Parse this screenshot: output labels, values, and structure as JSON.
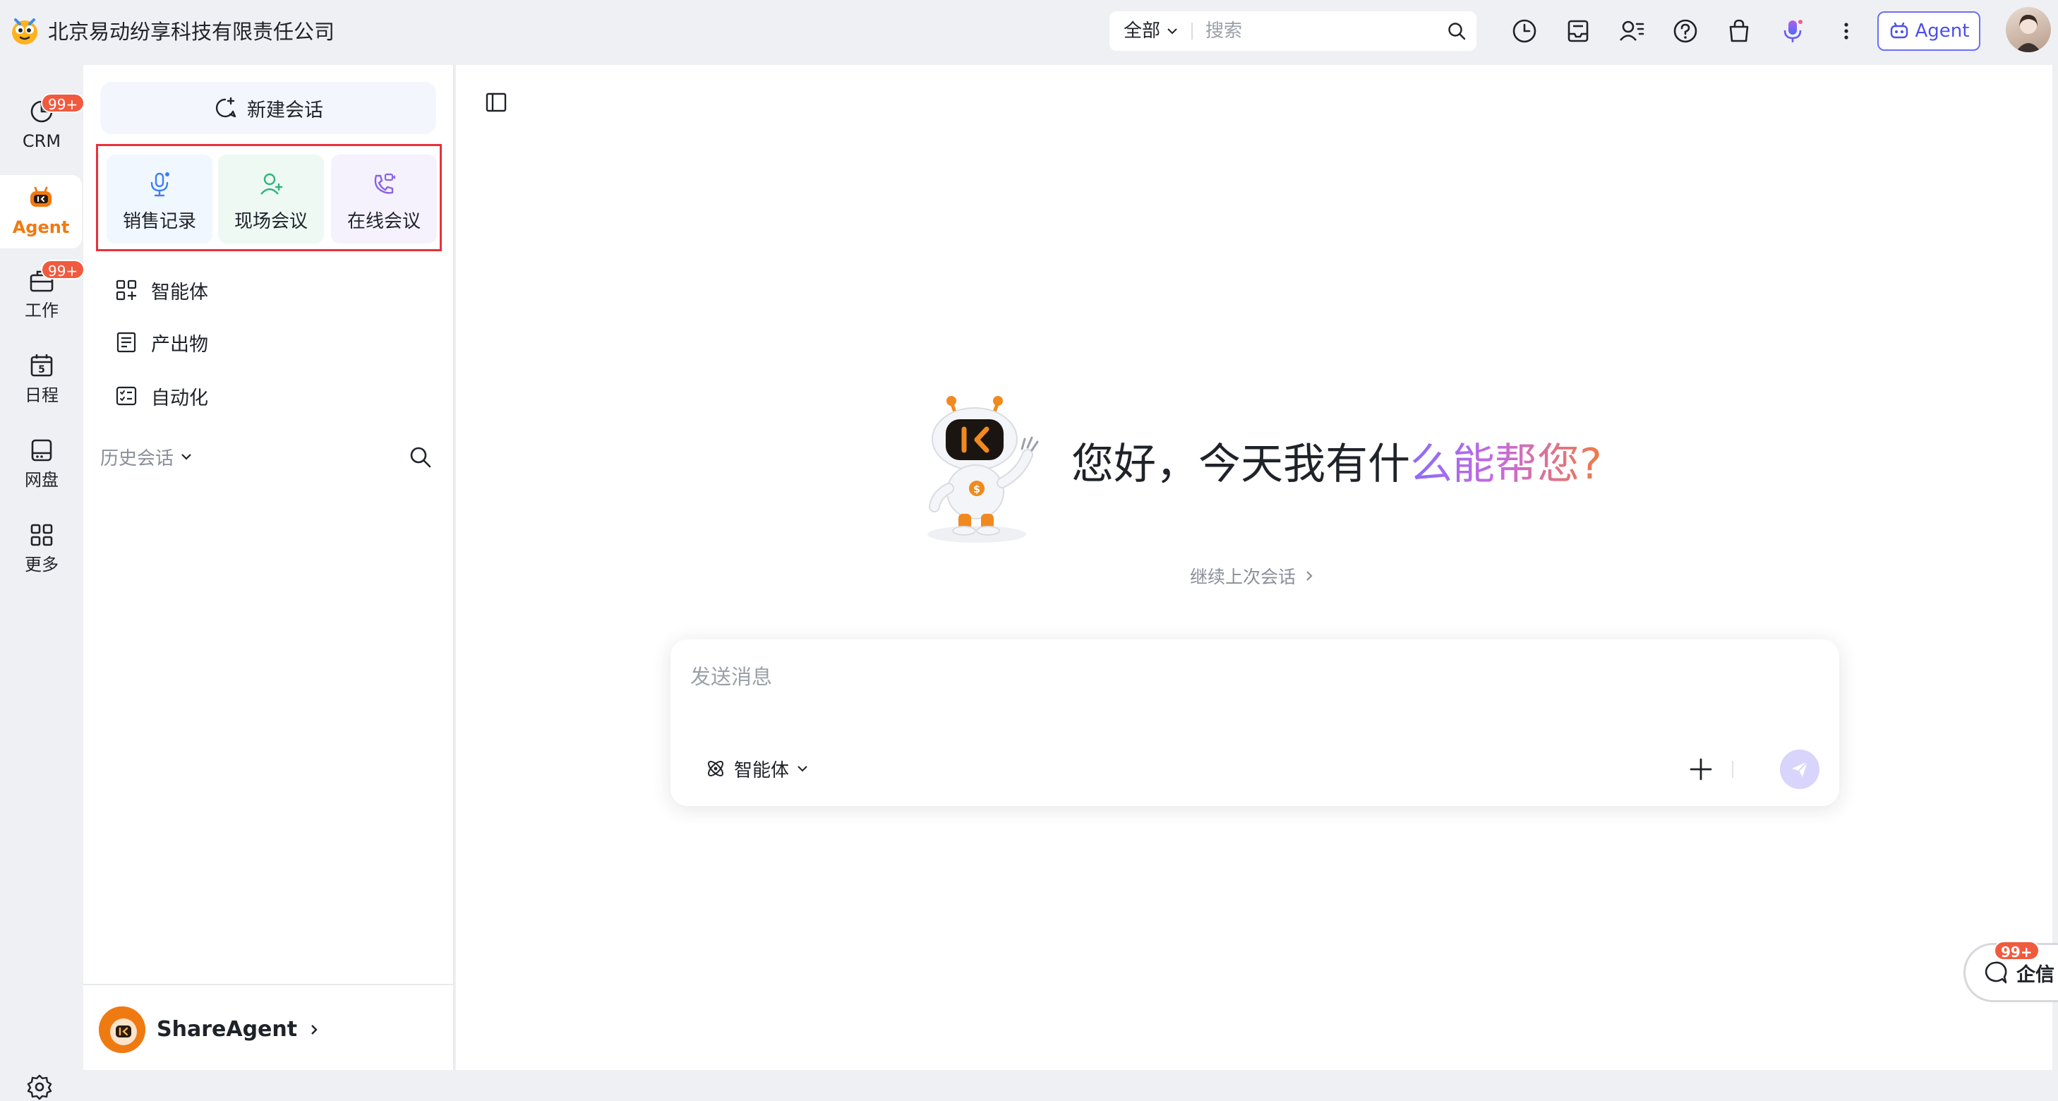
{
  "topbar": {
    "company": "北京易动纷享科技有限责任公司",
    "search_scope": "全部",
    "search_placeholder": "搜索",
    "agent_label": "Agent"
  },
  "rail": {
    "items": [
      {
        "label": "CRM",
        "icon": "pie-chart-icon",
        "badge": "99+"
      },
      {
        "label": "Agent",
        "icon": "agent-robot-icon",
        "active": true
      },
      {
        "label": "工作",
        "icon": "briefcase-icon",
        "badge": "99+"
      },
      {
        "label": "日程",
        "icon": "calendar-icon",
        "calendar_day": "5"
      },
      {
        "label": "网盘",
        "icon": "disk-icon"
      },
      {
        "label": "更多",
        "icon": "grid-icon"
      }
    ]
  },
  "panel": {
    "new_chat": "新建会话",
    "quick_actions": [
      {
        "label": "销售记录",
        "icon": "microphone-icon",
        "bg": "#f1f7ff"
      },
      {
        "label": "现场会议",
        "icon": "people-add-icon",
        "bg": "#eef9f4"
      },
      {
        "label": "在线会议",
        "icon": "phone-video-icon",
        "bg": "#f5f2fd"
      }
    ],
    "menu": [
      {
        "label": "智能体",
        "icon": "apps-add-icon"
      },
      {
        "label": "产出物",
        "icon": "document-icon"
      },
      {
        "label": "自动化",
        "icon": "checklist-icon"
      }
    ],
    "history_label": "历史会话",
    "footer_name": "ShareAgent"
  },
  "main": {
    "greeting_plain": "您好，今天我有什",
    "greeting_gradient": "么能帮您?",
    "continue_label": "继续上次会话",
    "composer_placeholder": "发送消息",
    "agent_picker_label": "智能体"
  },
  "floating": {
    "chat_label": "企信",
    "badge": "99+"
  },
  "colors": {
    "accent_orange": "#f07a12",
    "badge_red": "#f05a3f",
    "agent_blue": "#4b50e6",
    "highlight_red": "#e8313a"
  }
}
